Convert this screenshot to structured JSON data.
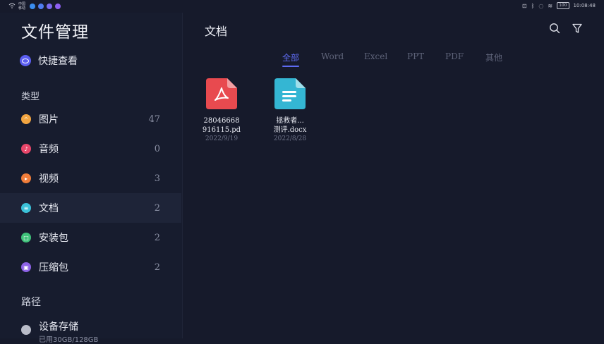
{
  "status_bar": {
    "carrier": "中国 移动",
    "battery": "100",
    "time": "10:08:48"
  },
  "sidebar": {
    "app_title": "文件管理",
    "quick_view": "快捷查看",
    "types_label": "类型",
    "items": [
      {
        "label": "图片",
        "count": "47",
        "icon": "image-icon",
        "color": "#f2a541"
      },
      {
        "label": "音频",
        "count": "0",
        "icon": "music-icon",
        "color": "#e8466a"
      },
      {
        "label": "视频",
        "count": "3",
        "icon": "video-icon",
        "color": "#f07d3a"
      },
      {
        "label": "文档",
        "count": "2",
        "icon": "document-icon",
        "color": "#3bc1d8"
      },
      {
        "label": "安装包",
        "count": "2",
        "icon": "package-icon",
        "color": "#3fc27a"
      },
      {
        "label": "压缩包",
        "count": "2",
        "icon": "archive-icon",
        "color": "#8e63e6"
      }
    ],
    "path_label": "路径",
    "storage": {
      "label": "设备存储",
      "sub": "已用30GB/128GB"
    }
  },
  "main": {
    "title": "文档",
    "tabs": [
      "全部",
      "Word",
      "Excel",
      "PPT",
      "PDF",
      "其他"
    ],
    "active_tab": "全部",
    "files": [
      {
        "name_line1": "28046668",
        "name_line2": "916115.pd",
        "date": "2022/9/19",
        "type": "pdf"
      },
      {
        "name_line1": "拯救者...",
        "name_line2": "测评.docx",
        "date": "2022/8/28",
        "type": "doc"
      }
    ]
  },
  "colors": {
    "accent": "#5e6bf2",
    "background": "#161a2b",
    "pdf": "#e84a4f",
    "doc": "#34b6d3"
  }
}
